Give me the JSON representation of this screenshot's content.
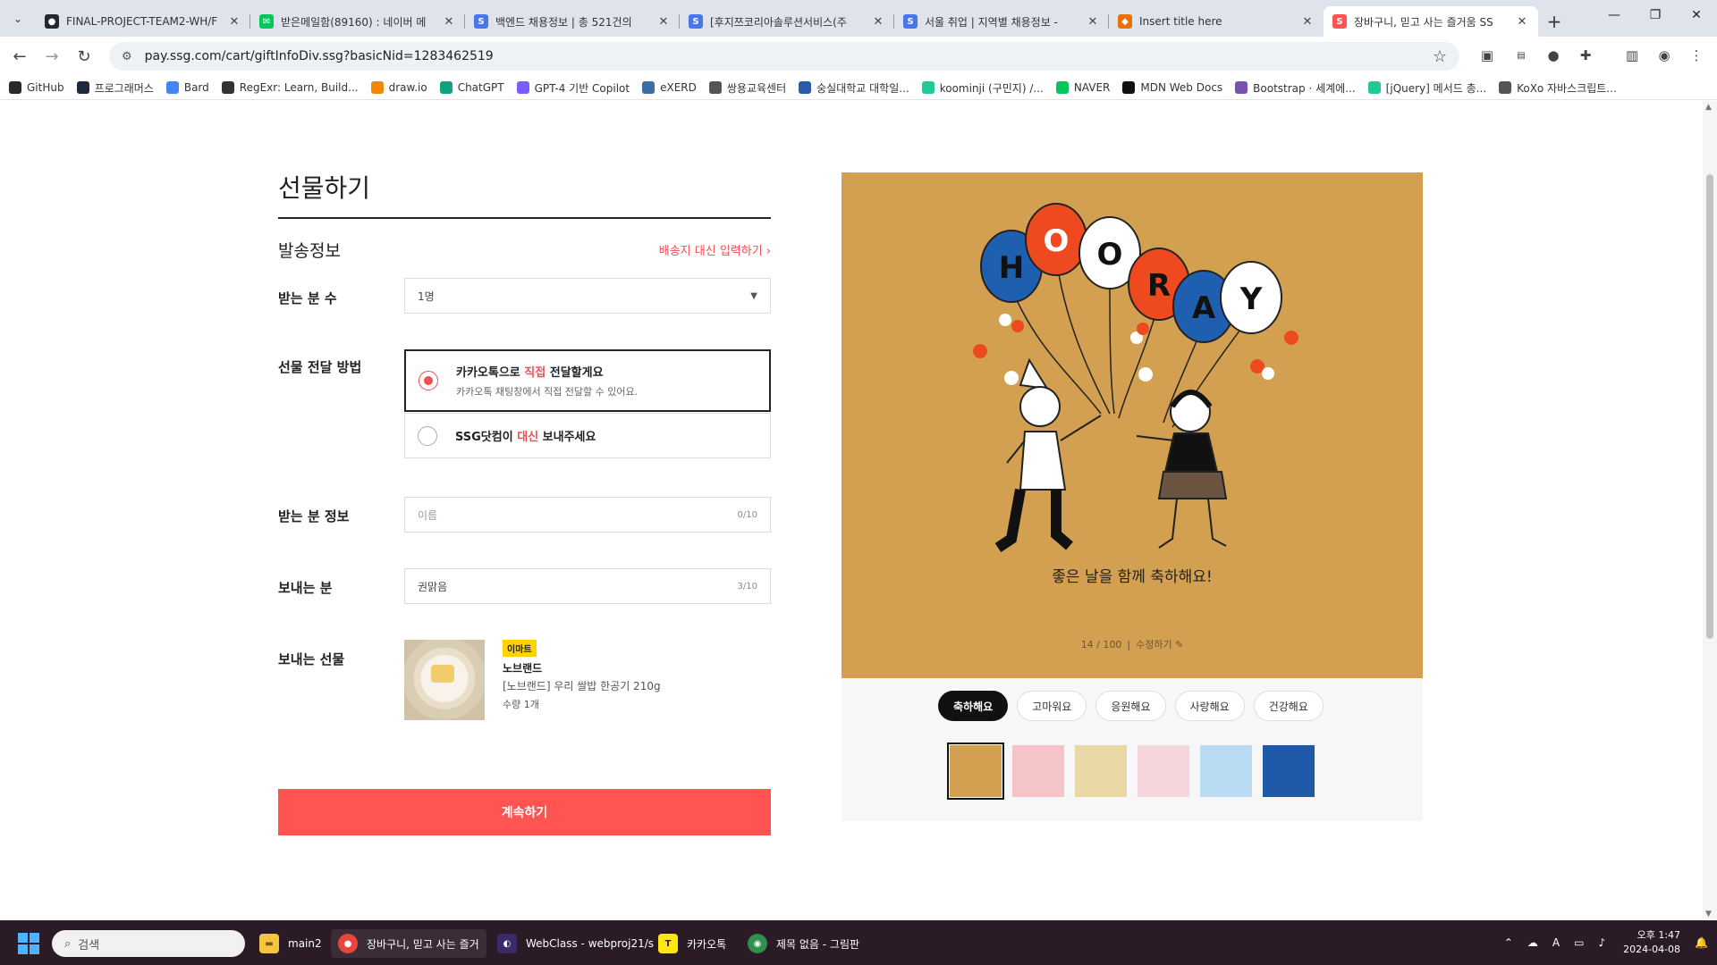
{
  "browser": {
    "tabs": [
      {
        "title": "FINAL-PROJECT-TEAM2-WH/F",
        "icon": "github-icon",
        "color": "#24292f"
      },
      {
        "title": "받은메일함(89160) : 네이버 메",
        "icon": "naver-mail-icon",
        "color": "#03c75a"
      },
      {
        "title": "백엔드 채용정보 | 총 521건의",
        "icon": "saramin-icon",
        "color": "#4876ef"
      },
      {
        "title": "[후지쯔코리아솔루션서비스(주",
        "icon": "saramin-icon",
        "color": "#4876ef"
      },
      {
        "title": "서울 취업 | 지역별 채용정보 -",
        "icon": "saramin-icon",
        "color": "#4876ef"
      },
      {
        "title": "Insert title here",
        "icon": "page-icon",
        "color": "#e8710a"
      },
      {
        "title": "장바구니, 믿고 사는 즐거움 SS",
        "icon": "ssg-icon",
        "color": "#ff5452"
      }
    ],
    "url": "pay.ssg.com/cart/giftInfoDiv.ssg?basicNid=1283462519",
    "bookmarks": [
      {
        "label": "GitHub",
        "icon": "github-icon",
        "color": "#24292f"
      },
      {
        "label": "프로그래머스",
        "icon": "programmers-icon",
        "color": "#1e2a3b"
      },
      {
        "label": "Bard",
        "icon": "bard-icon",
        "color": "#4285f4"
      },
      {
        "label": "RegExr: Learn, Build...",
        "icon": "regexr-icon",
        "color": "#333"
      },
      {
        "label": "draw.io",
        "icon": "drawio-icon",
        "color": "#f08705"
      },
      {
        "label": "ChatGPT",
        "icon": "chatgpt-icon",
        "color": "#10a37f"
      },
      {
        "label": "GPT-4 기반 Copilot",
        "icon": "copilot-icon",
        "color": "#7b5cff"
      },
      {
        "label": "eXERD",
        "icon": "exerd-icon",
        "color": "#3a6ea5"
      },
      {
        "label": "쌍용교육센터",
        "icon": "globe-icon",
        "color": "#555"
      },
      {
        "label": "숭실대학교 대학일...",
        "icon": "ssu-icon",
        "color": "#2a5caa"
      },
      {
        "label": "koominji (구민지) /...",
        "icon": "velog-icon",
        "color": "#20c997"
      },
      {
        "label": "NAVER",
        "icon": "naver-icon",
        "color": "#03c75a"
      },
      {
        "label": "MDN Web Docs",
        "icon": "mdn-icon",
        "color": "#111"
      },
      {
        "label": "Bootstrap · 세계에...",
        "icon": "bootstrap-icon",
        "color": "#7952b3"
      },
      {
        "label": "[jQuery] 메서드 총...",
        "icon": "velog-icon",
        "color": "#20c997"
      },
      {
        "label": "KoXo 자바스크립트...",
        "icon": "globe-icon",
        "color": "#555"
      }
    ]
  },
  "form": {
    "title": "선물하기",
    "section": "발송정보",
    "address_link": "배송지 대신 입력하기 ›",
    "recipients_label": "받는 분 수",
    "recipients_value": "1명",
    "method_label": "선물 전달 방법",
    "option1": {
      "pre": "카카오톡으로 ",
      "hl": "직접",
      "post": " 전달할게요",
      "sub": "카카오톡 채팅창에서 직접 전달할 수 있어요."
    },
    "option2": {
      "pre": "SSG닷컴이 ",
      "hl": "대신",
      "post": " 보내주세요"
    },
    "receiver_label": "받는 분 정보",
    "receiver_placeholder": "이름",
    "receiver_count": "0/10",
    "sender_label": "보내는 분",
    "sender_value": "권맑음",
    "sender_count": "3/10",
    "gift_label": "보내는 선물",
    "product": {
      "badge": "이마트",
      "brand": "노브랜드",
      "name": "[노브랜드] 우리 쌀밥 한공기 210g",
      "qty": "수량 1개"
    },
    "cta": "계속하기"
  },
  "card": {
    "balloon_letters": [
      "H",
      "O",
      "O",
      "R",
      "A",
      "Y"
    ],
    "message": "좋은 날을 함께 축하해요!",
    "counter": "14 / 100",
    "edit_label": "수정하기",
    "categories": [
      "축하해요",
      "고마워요",
      "응원해요",
      "사랑해요",
      "건강해요"
    ],
    "active_category": "축하해요",
    "thumb_colors": [
      "#d2a050",
      "#f4c4c8",
      "#e9d8a6",
      "#f5d6dc",
      "#b9dcf4",
      "#1e5aa8"
    ]
  },
  "taskbar": {
    "search": "검색",
    "items": [
      {
        "label": "main2",
        "icon": "folder-icon"
      },
      {
        "label": "장바구니, 믿고 사는 즐거",
        "icon": "chrome-icon"
      },
      {
        "label": "WebClass - webproj21/s",
        "icon": "eclipse-icon"
      },
      {
        "label": "카카오톡",
        "icon": "kakaotalk-icon"
      },
      {
        "label": "제목 없음 - 그림판",
        "icon": "paint-icon"
      }
    ],
    "time": "오후 1:47",
    "date": "2024-04-08"
  }
}
